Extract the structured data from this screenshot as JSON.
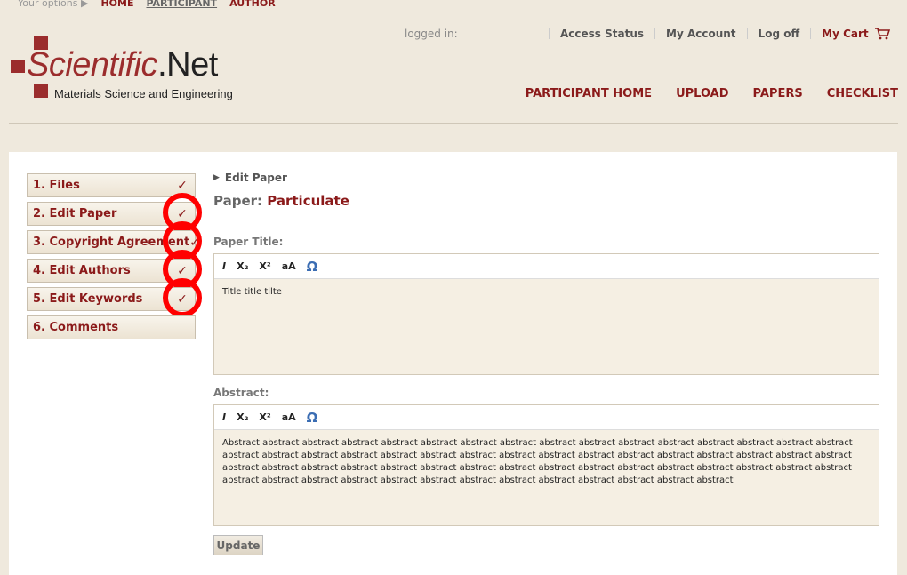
{
  "topbar": {
    "options": "Your options ▶",
    "home": "HOME",
    "participant": "PARTICIPANT",
    "author": "AUTHOR"
  },
  "logo": {
    "brand_scientific": "Scientific",
    "brand_net": ".Net",
    "tagline": "Materials Science and Engineering"
  },
  "account": {
    "logged_in": "logged in:",
    "access_status": "Access Status",
    "my_account": "My Account",
    "log_off": "Log off",
    "my_cart": "My Cart"
  },
  "main_nav": [
    "PARTICIPANT HOME",
    "UPLOAD",
    "PAPERS",
    "CHECKLIST"
  ],
  "steps": [
    {
      "label": "1. Files",
      "checked": true,
      "circled": false
    },
    {
      "label": "2. Edit Paper",
      "checked": true,
      "circled": true
    },
    {
      "label": "3. Copyright Agreement",
      "checked": true,
      "circled": true
    },
    {
      "label": "4. Edit Authors",
      "checked": true,
      "circled": true
    },
    {
      "label": "5. Edit Keywords",
      "checked": true,
      "circled": true
    },
    {
      "label": "6. Comments",
      "checked": false,
      "circled": false
    }
  ],
  "content": {
    "breadcrumb": "Edit Paper",
    "paper_prefix": "Paper:",
    "paper_name": "Particulate",
    "title_label": "Paper Title:",
    "title_value": "Title title tilte",
    "abstract_label": "Abstract:",
    "abstract_value": "Abstract abstract abstract abstract abstract abstract abstract abstract abstract abstract abstract abstract abstract abstract abstract abstract abstract abstract abstract abstract abstract abstract abstract abstract abstract abstract abstract abstract abstract abstract abstract abstract abstract abstract abstract abstract abstract abstract abstract abstract abstract abstract abstract abstract abstract abstract abstract abstract abstract abstract abstract abstract abstract abstract abstract abstract abstract abstract abstract abstract abstract",
    "update_label": "Update"
  },
  "toolbar": {
    "italic": "I",
    "subscript": "X₂",
    "superscript": "X²",
    "case": "aA",
    "special": "Ω"
  },
  "colors": {
    "brand": "#8b1a1a",
    "annotation": "#ff0000",
    "background": "#efe9dd"
  }
}
